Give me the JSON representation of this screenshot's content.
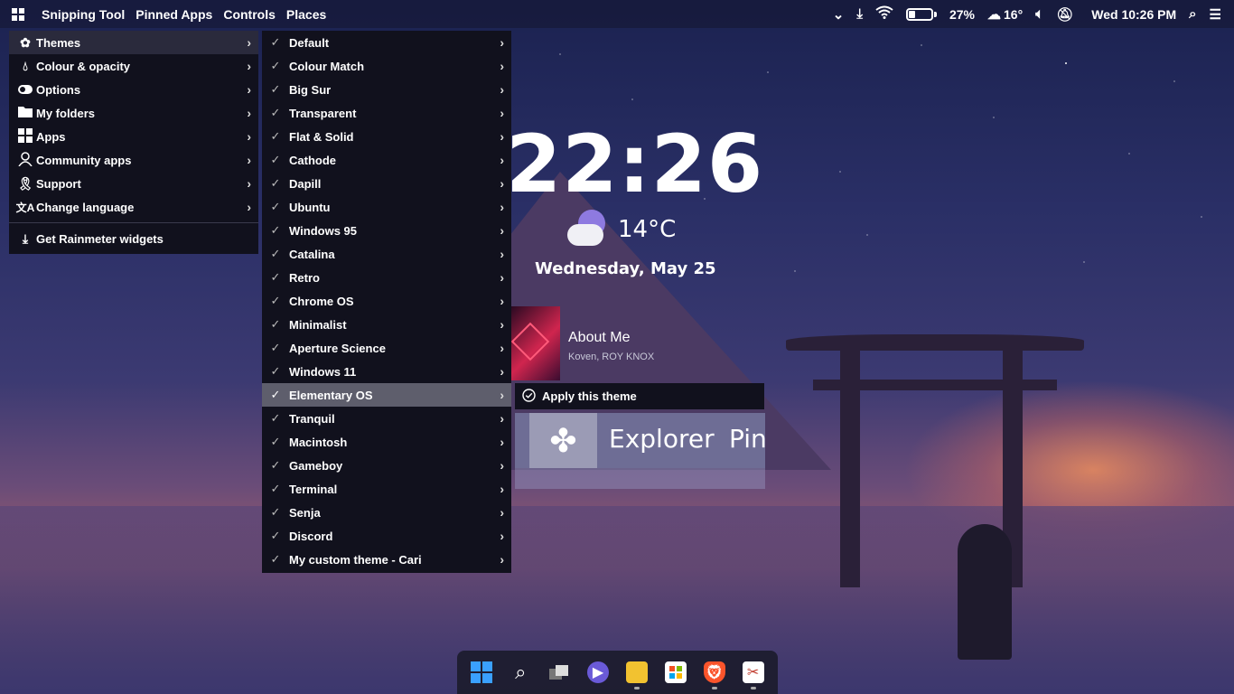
{
  "topbar": {
    "apps": [
      "Snipping Tool",
      "Pinned Apps",
      "Controls",
      "Places"
    ],
    "battery_percent": "27%",
    "battery_level": 0.27,
    "weather_temp": "16°",
    "datetime": "Wed 10:26 PM",
    "icons": [
      "chevron-down-icon",
      "download-icon",
      "wifi-icon",
      "battery-icon",
      "cloud-icon",
      "volume-icon",
      "notifications-off-icon",
      "search-icon",
      "list-icon"
    ]
  },
  "main_menu": {
    "items": [
      {
        "label": "Themes",
        "icon": "themes-icon"
      },
      {
        "label": "Colour & opacity",
        "icon": "drop-icon"
      },
      {
        "label": "Options",
        "icon": "toggle-icon"
      },
      {
        "label": "My folders",
        "icon": "folder-icon"
      },
      {
        "label": "Apps",
        "icon": "apps-icon"
      },
      {
        "label": "Community apps",
        "icon": "person-icon"
      },
      {
        "label": "Support",
        "icon": "ribbon-icon"
      },
      {
        "label": "Change language",
        "icon": "translate-icon"
      }
    ],
    "footer_item": {
      "label": "Get Rainmeter widgets",
      "icon": "download-icon"
    }
  },
  "themes_menu": {
    "items": [
      "Default",
      "Colour Match",
      "Big Sur",
      "Transparent",
      "Flat & Solid",
      "Cathode",
      "Dapill",
      "Ubuntu",
      "Windows 95",
      "Catalina",
      "Retro",
      "Chrome OS",
      "Minimalist",
      "Aperture Science",
      "Windows 11",
      "Elementary OS",
      "Tranquil",
      "Macintosh",
      "Gameboy",
      "Terminal",
      "Senja",
      "Discord",
      "My custom theme - Cari"
    ],
    "active": "Elementary OS"
  },
  "theme_submenu": {
    "apply_label": "Apply this theme"
  },
  "clock": {
    "time": "22:26",
    "temperature": "14°C",
    "date": "Wednesday, May 25"
  },
  "music": {
    "title": "About Me",
    "artist": "Koven, ROY KNOX"
  },
  "explorer_widget": {
    "label": "Explorer",
    "label2": "Pin"
  },
  "taskbar": {
    "apps": [
      "start-icon",
      "search-icon",
      "task-view-icon",
      "chat-icon",
      "file-explorer-icon",
      "store-icon",
      "brave-icon",
      "snipping-tool-icon"
    ]
  }
}
